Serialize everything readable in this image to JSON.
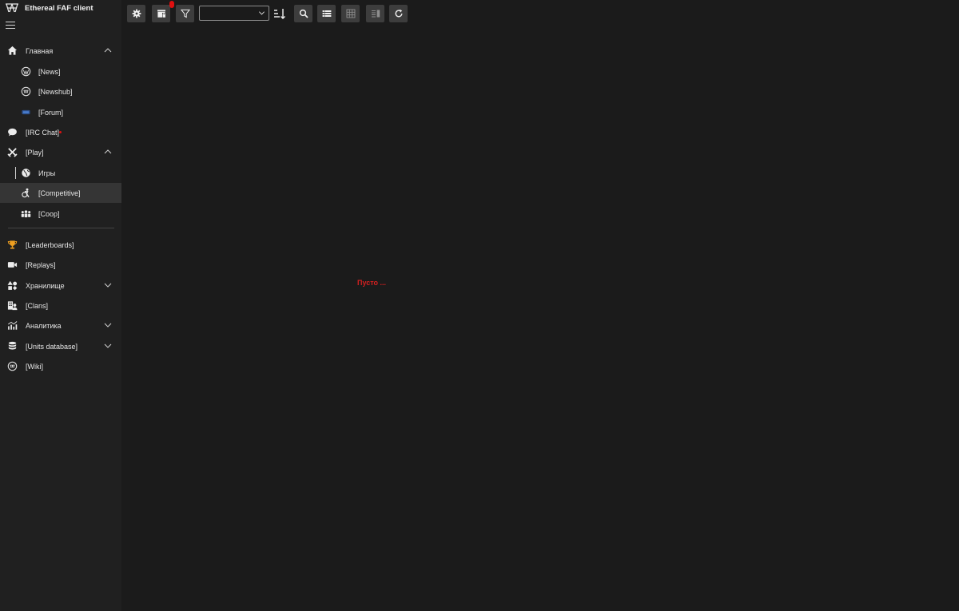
{
  "app": {
    "title": "Ethereal FAF client"
  },
  "nav": {
    "home": {
      "label": "Главная",
      "icon": "home-icon"
    },
    "news": {
      "label": "[News]",
      "icon": "wordpress-icon"
    },
    "newshub": {
      "label": "[Newshub]",
      "icon": "faf-icon"
    },
    "forum": {
      "label": "[Forum]",
      "icon": "forum-icon"
    },
    "irc": {
      "label": "[IRC Chat]",
      "icon": "chat-bubble-icon"
    },
    "play": {
      "label": "[Play]",
      "icon": "crossed-swords-icon"
    },
    "games": {
      "label": "Игры",
      "icon": "globe-icon"
    },
    "competitive": {
      "label": "[Competitive]",
      "icon": "competitive-icon"
    },
    "coop": {
      "label": "[Coop]",
      "icon": "group-icon"
    },
    "leaderboards": {
      "label": "[Leaderboards]",
      "icon": "trophy-icon"
    },
    "replays": {
      "label": "[Replays]",
      "icon": "video-camera-icon"
    },
    "vault": {
      "label": "Хранилище",
      "icon": "shapes-icon"
    },
    "clans": {
      "label": "[Clans]",
      "icon": "clans-icon"
    },
    "analytics": {
      "label": "Аналитика",
      "icon": "analytics-icon"
    },
    "units": {
      "label": "[Units database]",
      "icon": "database-icon"
    },
    "wiki": {
      "label": "[Wiki]",
      "icon": "faf-icon"
    }
  },
  "toolbar": {
    "sort_value": "",
    "buttons": [
      "gear-icon",
      "hosting-icon",
      "filter-icon",
      "sort-direction-icon",
      "search-icon",
      "list-view-icon",
      "grid-view-icon",
      "details-view-icon",
      "refresh-icon"
    ]
  },
  "content": {
    "empty_message": "Пусто ..."
  },
  "colors": {
    "background": "#1b1b1b",
    "sidebar": "#202020",
    "selected": "#353535",
    "button": "#3d3d3d",
    "accent_red": "#d42020",
    "trophy": "#f0a020",
    "forum_blue": "#4a7fd0"
  }
}
